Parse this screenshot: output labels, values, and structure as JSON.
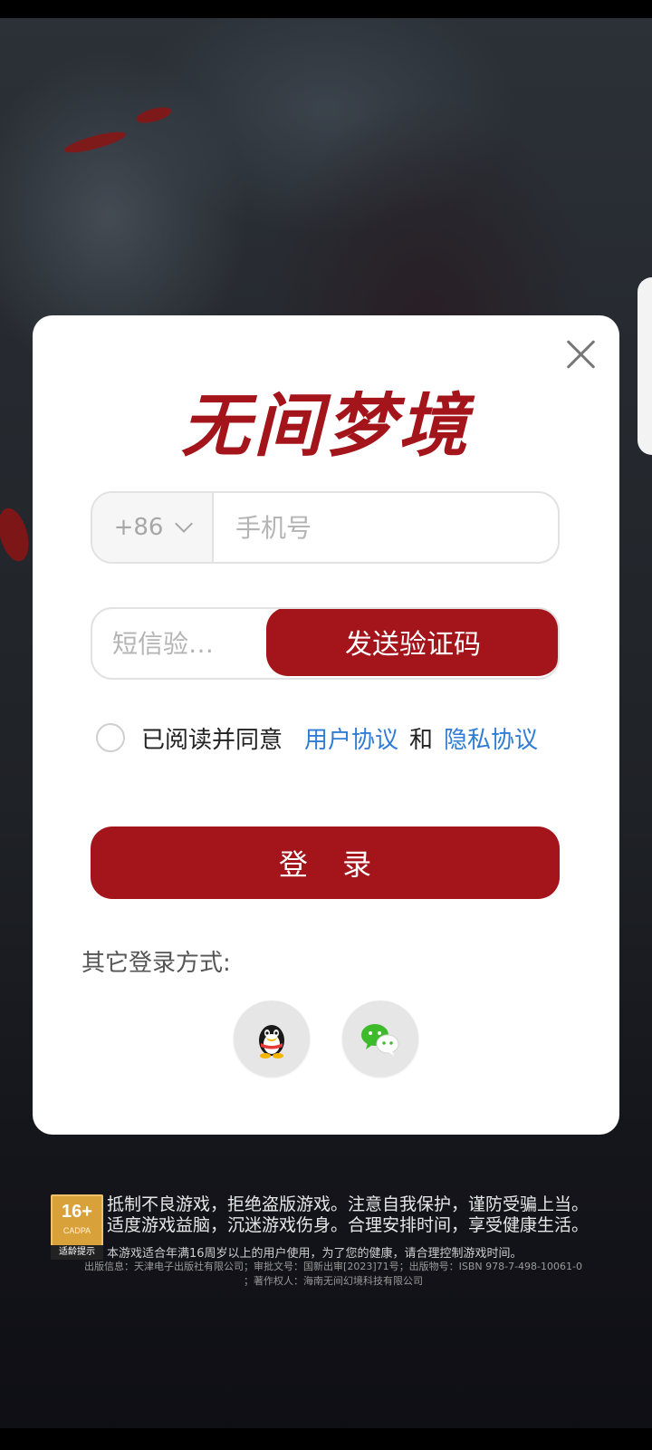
{
  "app": {
    "title": "无间梦境"
  },
  "login_dialog": {
    "country_code": "+86",
    "phone_placeholder": "手机号",
    "code_placeholder": "短信验…",
    "send_code_label": "发送验证码",
    "agree_text": "已阅读并同意",
    "user_agreement_link": "用户协议",
    "and_text": "和",
    "privacy_link": "隐私协议",
    "login_label": "登 录",
    "other_methods_label": "其它登录方式:",
    "social": [
      {
        "name": "qq",
        "icon": "qq-penguin-icon"
      },
      {
        "name": "wechat",
        "icon": "wechat-icon"
      }
    ],
    "colors": {
      "accent": "#a3151b",
      "link": "#2f7dd4"
    }
  },
  "footer": {
    "age_rating": "16+",
    "age_rating_org": "CADPA",
    "age_tip": "适龄提示",
    "slogan_line1": "抵制不良游戏，拒绝盗版游戏。注意自我保护，谨防受骗上当。",
    "slogan_line2": "适度游戏益脑，沉迷游戏伤身。合理安排时间，享受健康生活。",
    "age_notice": "本游戏适合年满16周岁以上的用户使用，为了您的健康，请合理控制游戏时间。",
    "pub_line1": "出版信息：天津电子出版社有限公司；审批文号：国新出审[2023]71号；出版物号：ISBN 978-7-498-10061-0",
    "pub_line2": "；著作权人：海南无间幻境科技有限公司"
  }
}
